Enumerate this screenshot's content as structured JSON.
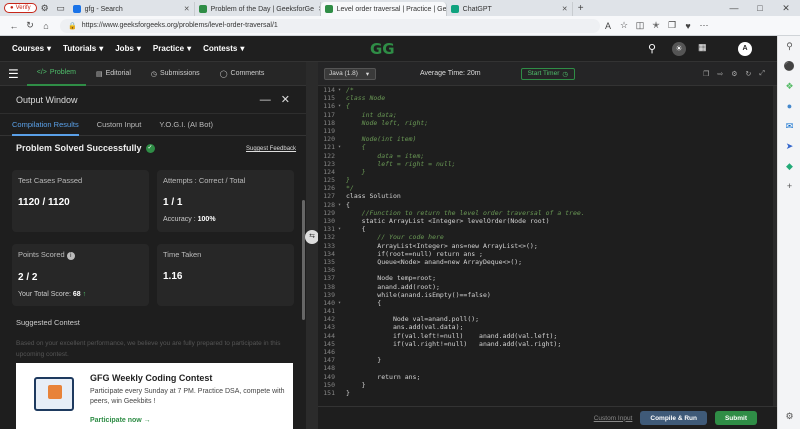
{
  "browser": {
    "verify_label": "Verify",
    "tabs": [
      {
        "title": "gfg - Search",
        "color": "#1a73e8"
      },
      {
        "title": "Problem of the Day | GeeksforGe",
        "color": "#2f8d46"
      },
      {
        "title": "Level order traversal | Practice | Ge",
        "color": "#2f8d46",
        "active": true
      },
      {
        "title": "ChatGPT",
        "color": "#10a37f"
      }
    ],
    "url": "https://www.geeksforgeeks.org/problems/level-order-traversal/1"
  },
  "header": {
    "menus": [
      "Courses",
      "Tutorials",
      "Jobs",
      "Practice",
      "Contests"
    ],
    "logo": "GG",
    "avatar_initial": "A"
  },
  "left_tabs": [
    "Problem",
    "Editorial",
    "Submissions",
    "Comments"
  ],
  "output": {
    "title": "Output Window",
    "subtabs": [
      "Compilation Results",
      "Custom Input",
      "Y.O.G.I. (AI Bot)"
    ],
    "status": "Problem Solved Successfully",
    "feedback": "Suggest Feedback",
    "cards": {
      "tests_label": "Test Cases Passed",
      "tests_value": "1120 / 1120",
      "attempts_label": "Attempts : Correct / Total",
      "attempts_value": "1 / 1",
      "accuracy_label": "Accuracy :",
      "accuracy_value": "100%",
      "points_label": "Points Scored",
      "points_value": "2 / 2",
      "total_label": "Your Total Score:",
      "total_value": "68",
      "time_label": "Time Taken",
      "time_value": "1.16"
    },
    "suggested_title": "Suggested Contest",
    "suggested_text": "Based on your excellent performance, we believe you are fully prepared to participate in this upcoming contest.",
    "contest": {
      "title": "GFG Weekly Coding Contest",
      "desc": "Participate every Sunday at 7 PM. Practice DSA, compete with peers, win Geekbits !",
      "link": "Participate now →"
    }
  },
  "editor": {
    "language": "Java (1.8)",
    "avg_time": "Average Time: 20m",
    "start_timer": "Start Timer",
    "custom_input": "Custom Input",
    "compile_run": "Compile & Run",
    "submit": "Submit"
  },
  "code_lines": [
    {
      "n": "114",
      "t": "/*",
      "c": "cmt",
      "f": "-"
    },
    {
      "n": "115",
      "t": "class Node",
      "c": "cmt"
    },
    {
      "n": "116",
      "t": "{",
      "c": "cmt",
      "f": "-"
    },
    {
      "n": "117",
      "t": "    int data;",
      "c": "cmt"
    },
    {
      "n": "118",
      "t": "    Node left, right;",
      "c": "cmt"
    },
    {
      "n": "119",
      "t": "",
      "c": "cmt"
    },
    {
      "n": "120",
      "t": "    Node(int item)",
      "c": "cmt"
    },
    {
      "n": "121",
      "t": "    {",
      "c": "cmt",
      "f": "-"
    },
    {
      "n": "122",
      "t": "        data = item;",
      "c": "cmt"
    },
    {
      "n": "123",
      "t": "        left = right = null;",
      "c": "cmt"
    },
    {
      "n": "124",
      "t": "    }",
      "c": "cmt"
    },
    {
      "n": "125",
      "t": "}",
      "c": "cmt"
    },
    {
      "n": "126",
      "t": "*/",
      "c": "cmt"
    },
    {
      "n": "127",
      "t": "class Solution",
      "c": "src"
    },
    {
      "n": "128",
      "t": "{",
      "c": "src",
      "f": "-"
    },
    {
      "n": "129",
      "t": "    //Function to return the level order traversal of a tree.",
      "c": "cmt"
    },
    {
      "n": "130",
      "t": "    static ArrayList <Integer> levelOrder(Node root)",
      "c": "src"
    },
    {
      "n": "131",
      "t": "    {",
      "c": "src",
      "f": "-"
    },
    {
      "n": "132",
      "t": "        // Your code here",
      "c": "cmt"
    },
    {
      "n": "133",
      "t": "        ArrayList<Integer> ans=new ArrayList<>();",
      "c": "src"
    },
    {
      "n": "134",
      "t": "        if(root==null) return ans ;",
      "c": "src"
    },
    {
      "n": "135",
      "t": "        Queue<Node> anand=new ArrayDeque<>();",
      "c": "src"
    },
    {
      "n": "136",
      "t": "",
      "c": "src"
    },
    {
      "n": "137",
      "t": "        Node temp=root;",
      "c": "src"
    },
    {
      "n": "138",
      "t": "        anand.add(root);",
      "c": "src"
    },
    {
      "n": "139",
      "t": "        while(anand.isEmpty()==false)",
      "c": "src"
    },
    {
      "n": "140",
      "t": "        {",
      "c": "src",
      "f": "-"
    },
    {
      "n": "141",
      "t": "",
      "c": "src"
    },
    {
      "n": "142",
      "t": "            Node val=anand.poll();",
      "c": "src"
    },
    {
      "n": "143",
      "t": "            ans.add(val.data);",
      "c": "src"
    },
    {
      "n": "144",
      "t": "            if(val.left!=null)    anand.add(val.left);",
      "c": "src"
    },
    {
      "n": "145",
      "t": "            if(val.right!=null)   anand.add(val.right);",
      "c": "src"
    },
    {
      "n": "146",
      "t": "",
      "c": "src"
    },
    {
      "n": "147",
      "t": "        }",
      "c": "src"
    },
    {
      "n": "148",
      "t": "",
      "c": "src"
    },
    {
      "n": "149",
      "t": "        return ans;",
      "c": "src"
    },
    {
      "n": "150",
      "t": "    }",
      "c": "src"
    },
    {
      "n": "151",
      "t": "}",
      "c": "src"
    }
  ],
  "colors": {
    "accent": "#2f8d46",
    "link": "#5aa0e8",
    "submit": "#2f8d46",
    "compile": "#3f5a78"
  }
}
